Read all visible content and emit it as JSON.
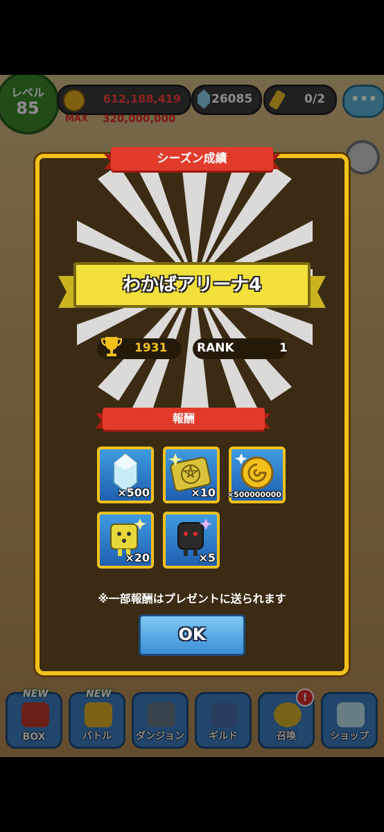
{
  "hud": {
    "level_label": "レベル",
    "level_value": "85",
    "coins": "612,188,419",
    "max_label": "MAX",
    "max_value": "320,000,000",
    "gems": "26085",
    "keys": "0/2",
    "chat_label": "•••"
  },
  "modal": {
    "title": "シーズン成績",
    "arena_name": "わかばアリーナ4",
    "trophy_value": "1931",
    "rank_label": "RANK",
    "rank_value": "1",
    "rewards_title": "報酬",
    "rewards": [
      {
        "icon": "gem-icon",
        "qty": "×500"
      },
      {
        "icon": "summon-ticket-icon",
        "qty": "×10"
      },
      {
        "icon": "gold-coin-icon",
        "qty": "×500000000"
      },
      {
        "icon": "yellow-dice-icon",
        "qty": "×20"
      },
      {
        "icon": "dark-crystal-icon",
        "qty": "×5"
      }
    ],
    "note": "※一部報酬はプレゼントに送られます",
    "ok_label": "OK"
  },
  "nav": {
    "items": [
      {
        "label": "BOX",
        "badge": "NEW"
      },
      {
        "label": "バトル",
        "badge": "NEW"
      },
      {
        "label": "ダンジョン"
      },
      {
        "label": "ギルド"
      },
      {
        "label": "召喚",
        "alert": "!"
      },
      {
        "label": "ショップ"
      }
    ]
  },
  "colors": {
    "modal_border": "#f3c11a",
    "ribbon": "#e23b2b",
    "ok_button": "#3c8fd6"
  }
}
